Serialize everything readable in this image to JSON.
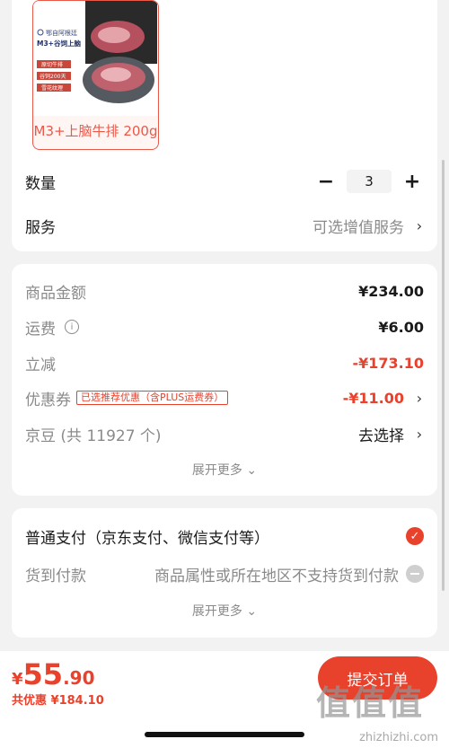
{
  "product": {
    "sku_name": "M3+上脑牛排 200g",
    "image_lines": [
      "鄂自阿根廷",
      "M3+谷饲上脑",
      "原切牛排",
      "谷饲200天",
      "雪花纹理"
    ]
  },
  "quantity": {
    "label": "数量",
    "minus": "−",
    "value": "3",
    "plus": "+"
  },
  "service": {
    "label": "服务",
    "value": "可选增值服务"
  },
  "summary": {
    "goods": {
      "label": "商品金额",
      "value": "¥234.00"
    },
    "shipping": {
      "label": "运费",
      "value": "¥6.00"
    },
    "discount": {
      "label": "立减",
      "value": "-¥173.10"
    },
    "coupon": {
      "label": "优惠券",
      "tag": "已选推荐优惠（含PLUS运费券）",
      "value": "-¥11.00"
    },
    "jingdou": {
      "label": "京豆 (共 11927 个)",
      "value": "去选择"
    },
    "expand": "展开更多"
  },
  "payment": {
    "normal": "普通支付（京东支付、微信支付等）",
    "cod_label": "货到付款",
    "cod_note": "商品属性或所在地区不支持货到付款",
    "expand": "展开更多"
  },
  "bottom": {
    "currency": "¥",
    "price_int": "55",
    "price_dec": ".90",
    "saved": "共优惠 ¥184.10",
    "submit": "提交订单"
  },
  "watermark": {
    "logo": "值值值",
    "url": "zhizhizhi.com"
  },
  "colors": {
    "accent": "#e8412c",
    "background": "#f2f2f2"
  }
}
